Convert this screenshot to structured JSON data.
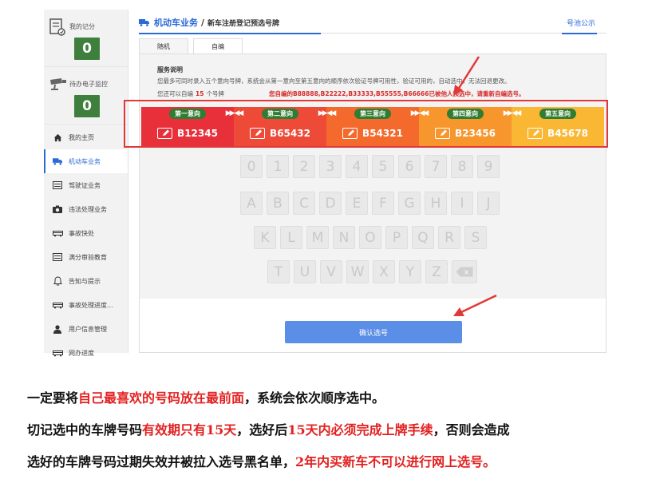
{
  "sidebar": {
    "points": {
      "label": "我的记分",
      "count": "0",
      "icon": "score-doc-icon"
    },
    "monitor": {
      "label": "待办电子监控",
      "count": "0",
      "icon": "camera-monitor-icon"
    },
    "items": [
      {
        "label": "我的主页",
        "icon": "home-icon"
      },
      {
        "label": "机动车业务",
        "icon": "truck-icon"
      },
      {
        "label": "驾驶证业务",
        "icon": "license-card-icon"
      },
      {
        "label": "违法处理业务",
        "icon": "camera-icon"
      },
      {
        "label": "事故快处",
        "icon": "car-icon"
      },
      {
        "label": "满分审验教育",
        "icon": "card-icon"
      },
      {
        "label": "告知与提示",
        "icon": "bell-icon"
      },
      {
        "label": "事故处理进度...",
        "icon": "car-progress-icon"
      },
      {
        "label": "用户信息管理",
        "icon": "user-icon"
      },
      {
        "label": "网办进度",
        "icon": "progress-icon"
      }
    ]
  },
  "header": {
    "title": "机动车业务",
    "sep": "/",
    "subtitle": "新车注册登记预选号牌",
    "pool_link": "号池公示"
  },
  "tabs": [
    {
      "label": "随机"
    },
    {
      "label": "自编"
    }
  ],
  "info": {
    "title": "服务说明",
    "text": "您最多可同时录入五个意向号牌，系统会从第一意向至第五意向的顺序依次验证号牌可用性，验证可用的，自动选中，无法回退更改。",
    "count_prefix": "您还可以自编",
    "count_value": "15",
    "count_suffix": "个号牌",
    "warning": "您自编的B88888,B22222,B33333,B55555,B66666已被他人预选中，请重新自编选号。"
  },
  "plates": [
    {
      "rank": "第一意向",
      "plate": "B12345",
      "color": "#e8303b"
    },
    {
      "rank": "第二意向",
      "plate": "B65432",
      "color": "#ee4a38"
    },
    {
      "rank": "第三意向",
      "plate": "B54321",
      "color": "#f36a2c"
    },
    {
      "rank": "第四意向",
      "plate": "B23456",
      "color": "#f7962d"
    },
    {
      "rank": "第五意向",
      "plate": "B45678",
      "color": "#f9b733"
    }
  ],
  "keyboard": {
    "row1": [
      "0",
      "1",
      "2",
      "3",
      "4",
      "5",
      "6",
      "7",
      "8",
      "9"
    ],
    "row2": [
      "A",
      "B",
      "C",
      "D",
      "E",
      "F",
      "G",
      "H",
      "I",
      "J"
    ],
    "row3": [
      "K",
      "L",
      "M",
      "N",
      "O",
      "P",
      "Q",
      "R",
      "S"
    ],
    "row4": [
      "T",
      "U",
      "V",
      "W",
      "X",
      "Y",
      "Z"
    ],
    "backspace": "x"
  },
  "confirm_label": "确认选号",
  "notes": {
    "l1a": "一定要将",
    "l1b": "自己最喜欢的号码放在最前面",
    "l1c": "，系统会依次顺序选中。",
    "l2a": "切记选中的车牌号码",
    "l2b": "有效期只有15天",
    "l2c": "，选好后",
    "l2d": "15天内必须完成上牌手续",
    "l2e": "，否则会造成",
    "l3a": "选好的车牌号码过期失效并被拉入选号黑名单，",
    "l3b": "2年内买新车不可以进行网上选号。"
  }
}
